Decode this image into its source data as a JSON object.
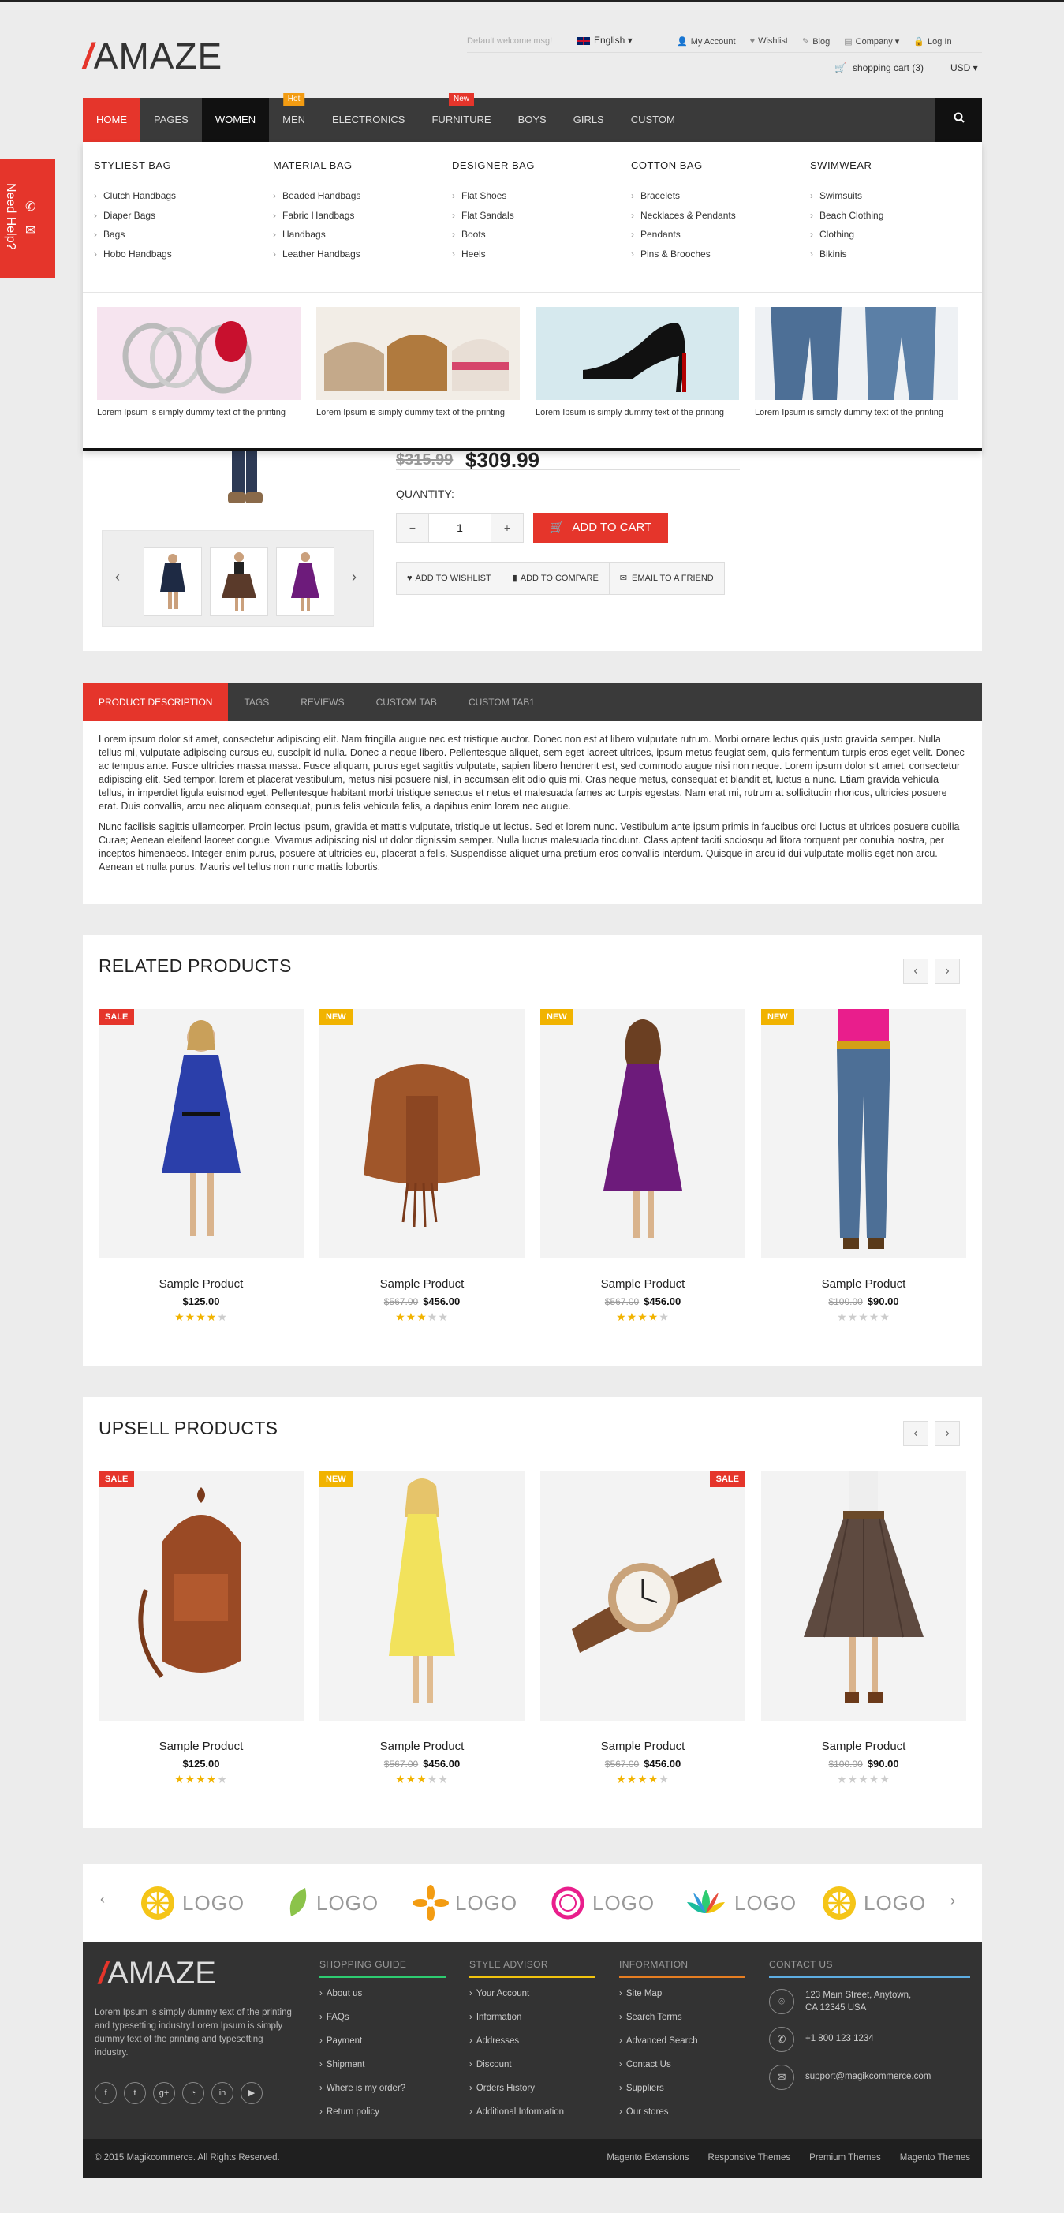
{
  "header": {
    "logo": "AMAZE",
    "welcome": "Default welcome msg!",
    "language": "English",
    "links": [
      "My Account",
      "Wishlist",
      "Blog",
      "Company",
      "Log In"
    ],
    "cart": "shopping cart (3)",
    "currency": "USD"
  },
  "nav": {
    "items": [
      "HOME",
      "PAGES",
      "WOMEN",
      "MEN",
      "ELECTRONICS",
      "FURNITURE",
      "BOYS",
      "GIRLS",
      "CUSTOM"
    ],
    "badge_hot": "Hot",
    "badge_new": "New"
  },
  "mega": {
    "columns": [
      {
        "title": "STYLIEST BAG",
        "items": [
          "Clutch Handbags",
          "Diaper Bags",
          "Bags",
          "Hobo Handbags"
        ]
      },
      {
        "title": "MATERIAL BAG",
        "items": [
          "Beaded Handbags",
          "Fabric Handbags",
          "Handbags",
          "Leather Handbags"
        ]
      },
      {
        "title": "DESIGNER BAG",
        "items": [
          "Flat Shoes",
          "Flat Sandals",
          "Boots",
          "Heels"
        ]
      },
      {
        "title": "COTTON BAG",
        "items": [
          "Bracelets",
          "Necklaces & Pendants",
          "Pendants",
          "Pins & Brooches"
        ]
      },
      {
        "title": "SWIMWEAR",
        "items": [
          "Swimsuits",
          "Beach Clothing",
          "Clothing",
          "Bikinis"
        ]
      }
    ],
    "promo_text": "Lorem Ipsum is simply dummy text of the printing"
  },
  "help": {
    "label": "Need Help?"
  },
  "product": {
    "old_price": "$315.99",
    "new_price": "$309.99",
    "quantity_label": "QUANTITY:",
    "quantity": "1",
    "minus": "−",
    "plus": "+",
    "add_to_cart": "ADD TO CART",
    "wishlist": "ADD TO WISHLIST",
    "compare": "ADD TO COMPARE",
    "email": "EMAIL TO A FRIEND"
  },
  "tabs": {
    "items": [
      "PRODUCT DESCRIPTION",
      "TAGS",
      "REVIEWS",
      "CUSTOM TAB",
      "CUSTOM TAB1"
    ],
    "p1": "Lorem ipsum dolor sit amet, consectetur adipiscing elit. Nam fringilla augue nec est tristique auctor. Donec non est at libero vulputate rutrum. Morbi ornare lectus quis justo gravida semper. Nulla tellus mi, vulputate adipiscing cursus eu, suscipit id nulla. Donec a neque libero. Pellentesque aliquet, sem eget laoreet ultrices, ipsum metus feugiat sem, quis fermentum turpis eros eget velit. Donec ac tempus ante. Fusce ultricies massa massa. Fusce aliquam, purus eget sagittis vulputate, sapien libero hendrerit est, sed commodo augue nisi non neque. Lorem ipsum dolor sit amet, consectetur adipiscing elit. Sed tempor, lorem et placerat vestibulum, metus nisi posuere nisl, in accumsan elit odio quis mi. Cras neque metus, consequat et blandit et, luctus a nunc. Etiam gravida vehicula tellus, in imperdiet ligula euismod eget. Pellentesque habitant morbi tristique senectus et netus et malesuada fames ac turpis egestas. Nam erat mi, rutrum at sollicitudin rhoncus, ultricies posuere erat. Duis convallis, arcu nec aliquam consequat, purus felis vehicula felis, a dapibus enim lorem nec augue.",
    "p2": "Nunc facilisis sagittis ullamcorper. Proin lectus ipsum, gravida et mattis vulputate, tristique ut lectus. Sed et lorem nunc. Vestibulum ante ipsum primis in faucibus orci luctus et ultrices posuere cubilia Curae; Aenean eleifend laoreet congue. Vivamus adipiscing nisl ut dolor dignissim semper. Nulla luctus malesuada tincidunt. Class aptent taciti sociosqu ad litora torquent per conubia nostra, per inceptos himenaeos. Integer enim purus, posuere at ultricies eu, placerat a felis. Suspendisse aliquet urna pretium eros convallis interdum. Quisque in arcu id dui vulputate mollis eget non arcu. Aenean et nulla purus. Mauris vel tellus non nunc mattis lobortis."
  },
  "related": {
    "title": "RELATED PRODUCTS",
    "prev": "‹",
    "next": "›",
    "products": [
      {
        "tag": "SALE",
        "name": "Sample Product",
        "old": "",
        "price": "$125.00",
        "rating": 4
      },
      {
        "tag": "NEW",
        "name": "Sample Product",
        "old": "$567.00",
        "price": "$456.00",
        "rating": 2.5
      },
      {
        "tag": "NEW",
        "name": "Sample Product",
        "old": "$567.00",
        "price": "$456.00",
        "rating": 4
      },
      {
        "tag": "NEW",
        "name": "Sample Product",
        "old": "$100.00",
        "price": "$90.00",
        "rating": 0
      }
    ]
  },
  "upsell": {
    "title": "UPSELL PRODUCTS",
    "prev": "‹",
    "next": "›",
    "products": [
      {
        "tag": "SALE",
        "name": "Sample Product",
        "old": "",
        "price": "$125.00",
        "rating": 4
      },
      {
        "tag": "NEW",
        "name": "Sample Product",
        "old": "$567.00",
        "price": "$456.00",
        "rating": 2.5
      },
      {
        "tag": "SALE",
        "name": "Sample Product",
        "old": "$567.00",
        "price": "$456.00",
        "rating": 4
      },
      {
        "tag": "",
        "name": "Sample Product",
        "old": "$100.00",
        "price": "$90.00",
        "rating": 0
      }
    ]
  },
  "brands": {
    "label": "LOGO",
    "prev": "‹",
    "next": "›"
  },
  "footer": {
    "logo": "AMAZE",
    "about": "Lorem Ipsum is simply dummy text of the printing and typesetting industry.Lorem Ipsum is simply dummy text of the printing and typesetting industry.",
    "columns": [
      {
        "title": "SHOPPING GUIDE",
        "color": "#2ecc71",
        "items": [
          "About us",
          "FAQs",
          "Payment",
          "Shipment",
          "Where is my order?",
          "Return policy"
        ]
      },
      {
        "title": "STYLE ADVISOR",
        "color": "#f1c40f",
        "items": [
          "Your Account",
          "Information",
          "Addresses",
          "Discount",
          "Orders History",
          "Additional Information"
        ]
      },
      {
        "title": "INFORMATION",
        "color": "#e67e22",
        "items": [
          "Site Map",
          "Search Terms",
          "Advanced Search",
          "Contact Us",
          "Suppliers",
          "Our stores"
        ]
      }
    ],
    "contact_title": "CONTACT US",
    "address": "123 Main Street, Anytown, CA 12345 USA",
    "phone": "+1 800 123 1234",
    "email": "support@magikcommerce.com",
    "copyright": "© 2015 Magikcommerce. All Rights Reserved.",
    "bottom_links": [
      "Magento Extensions",
      "Responsive Themes",
      "Premium Themes",
      "Magento Themes"
    ]
  },
  "colors": {
    "accent": "#e5352b",
    "dark": "#3a3a3a",
    "new_badge": "#f1b300"
  }
}
